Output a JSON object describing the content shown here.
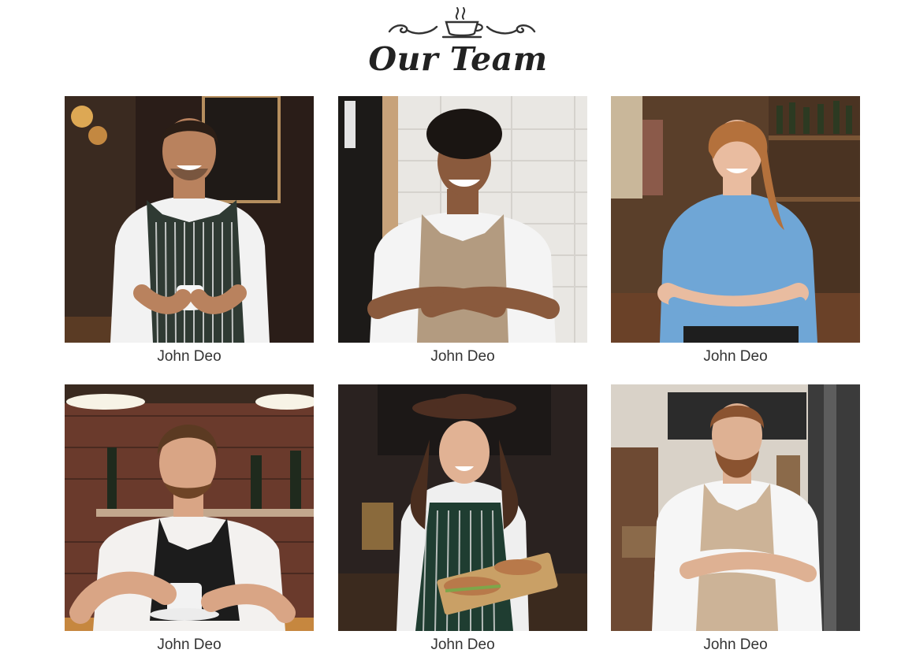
{
  "header": {
    "title": "Our Team",
    "ornament_icon": "coffee-cup-flourish-icon"
  },
  "team": [
    {
      "name": "John Deo",
      "apron": "#2f3a33",
      "apron_stripe": "#e6e6e6",
      "shirt": "#f2f2f2",
      "hair": "#2b1e16",
      "skin": "#b9825e",
      "bg": "#2a1d18"
    },
    {
      "name": "John Deo",
      "apron": "#b39b80",
      "apron_stripe": "",
      "shirt": "#f4f4f4",
      "hair": "#1a1512",
      "skin": "#8a5a3d",
      "bg": "#e9e7e3"
    },
    {
      "name": "John Deo",
      "apron": "#1e1e1e",
      "apron_stripe": "",
      "shirt": "#6fa6d6",
      "hair": "#b4713c",
      "skin": "#e9bca0",
      "bg": "#5a3f2a"
    },
    {
      "name": "John Deo",
      "apron": "#1c1c1c",
      "apron_stripe": "",
      "shirt": "#f3f1ef",
      "hair": "#5b3a22",
      "skin": "#d9a585",
      "bg": "#6a3a2c"
    },
    {
      "name": "John Deo",
      "apron": "#1f3d31",
      "apron_stripe": "#dcdcdc",
      "shirt": "#efefef",
      "hair": "#4a2e1f",
      "skin": "#e1b294",
      "bg": "#2a2220"
    },
    {
      "name": "John Deo",
      "apron": "#ccb397",
      "apron_stripe": "",
      "shirt": "#f6f6f6",
      "hair": "#8a5330",
      "skin": "#deb193",
      "bg": "#d9d2c8"
    }
  ]
}
